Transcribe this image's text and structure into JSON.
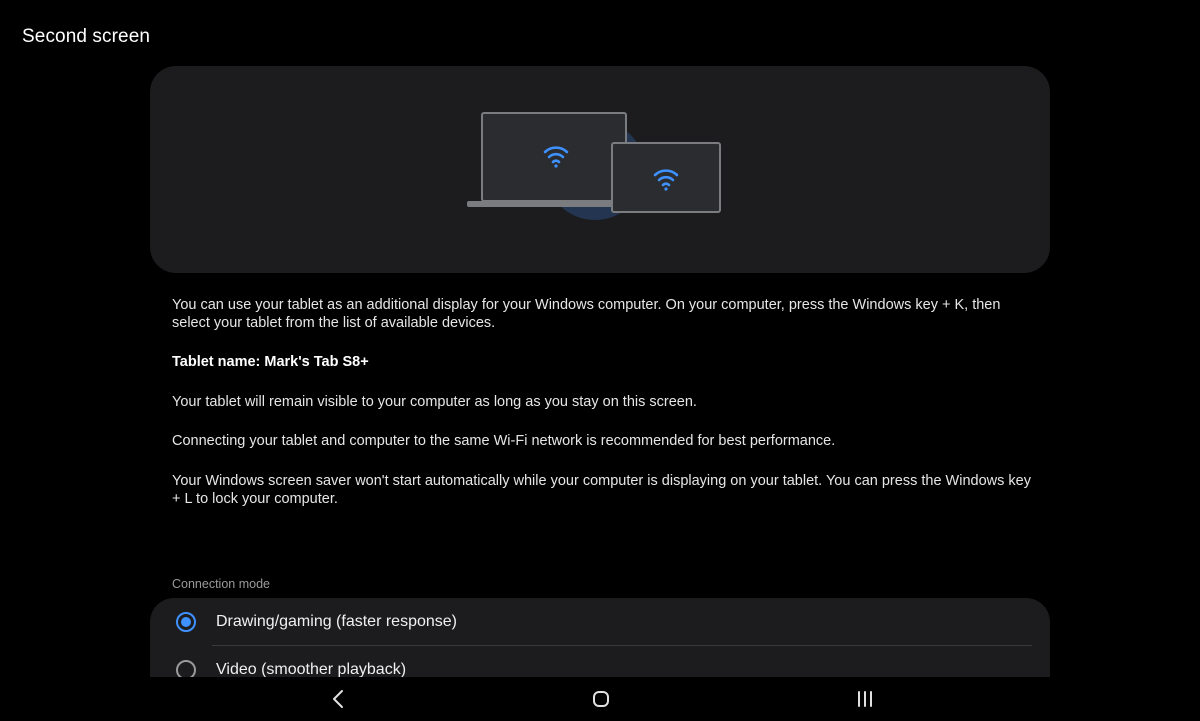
{
  "header": {
    "title": "Second screen"
  },
  "illustration": {
    "laptop_icon": "laptop-icon",
    "tablet_icon": "tablet-icon",
    "wifi_icon": "wifi-icon",
    "accent_color": "#3e91ff"
  },
  "description": {
    "intro": "You can use your tablet as an additional display for your Windows computer. On your computer, press the Windows key + K, then select your tablet from the list of available devices.",
    "tablet_name": "Tablet name: Mark's Tab S8+",
    "visibility_note": "Your tablet will remain visible to your computer as long as you stay on this screen.",
    "wifi_note": "Connecting your tablet and computer to the same Wi-Fi network is recommended for best performance.",
    "screensaver_note": "Your Windows screen saver won't start automatically while your computer is displaying on your tablet. You can press the Windows key + L to lock your computer."
  },
  "connection_mode": {
    "label": "Connection mode",
    "options": [
      {
        "label": "Drawing/gaming (faster response)",
        "selected": true
      },
      {
        "label": "Video (smoother playback)",
        "selected": false
      }
    ]
  },
  "nav_bar": {
    "back_icon": "back-icon",
    "home_icon": "home-icon",
    "recents_icon": "recents-icon"
  }
}
